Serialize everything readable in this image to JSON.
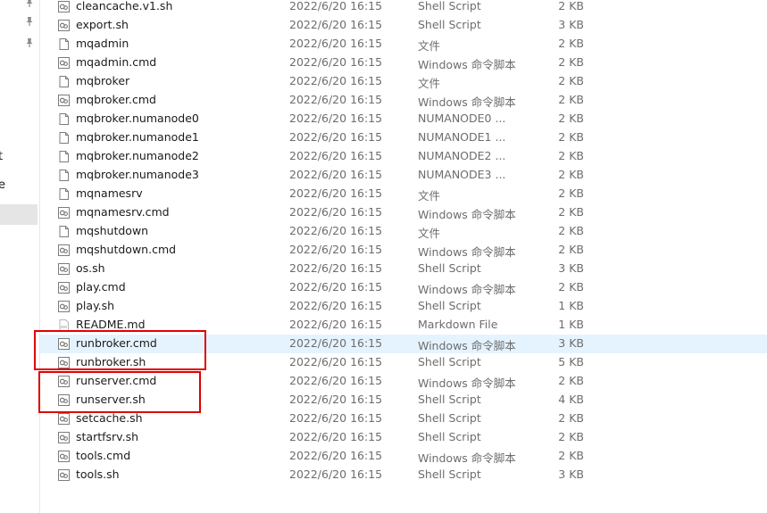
{
  "nav": {
    "text_fragments": [
      "t",
      "e"
    ],
    "icons": [
      "pin-icon",
      "pin-icon",
      "pin-icon"
    ]
  },
  "files": [
    {
      "name": "cleancache.v1.sh",
      "date": "2022/6/20 16:15",
      "type": "Shell Script",
      "size": "2 KB",
      "icon": "script-file-icon"
    },
    {
      "name": "export.sh",
      "date": "2022/6/20 16:15",
      "type": "Shell Script",
      "size": "3 KB",
      "icon": "script-file-icon"
    },
    {
      "name": "mqadmin",
      "date": "2022/6/20 16:15",
      "type": "文件",
      "size": "2 KB",
      "icon": "blank-file-icon"
    },
    {
      "name": "mqadmin.cmd",
      "date": "2022/6/20 16:15",
      "type": "Windows 命令脚本",
      "size": "2 KB",
      "icon": "script-file-icon"
    },
    {
      "name": "mqbroker",
      "date": "2022/6/20 16:15",
      "type": "文件",
      "size": "2 KB",
      "icon": "blank-file-icon"
    },
    {
      "name": "mqbroker.cmd",
      "date": "2022/6/20 16:15",
      "type": "Windows 命令脚本",
      "size": "2 KB",
      "icon": "script-file-icon"
    },
    {
      "name": "mqbroker.numanode0",
      "date": "2022/6/20 16:15",
      "type": "NUMANODE0 ...",
      "size": "2 KB",
      "icon": "blank-file-icon"
    },
    {
      "name": "mqbroker.numanode1",
      "date": "2022/6/20 16:15",
      "type": "NUMANODE1 ...",
      "size": "2 KB",
      "icon": "blank-file-icon"
    },
    {
      "name": "mqbroker.numanode2",
      "date": "2022/6/20 16:15",
      "type": "NUMANODE2 ...",
      "size": "2 KB",
      "icon": "blank-file-icon"
    },
    {
      "name": "mqbroker.numanode3",
      "date": "2022/6/20 16:15",
      "type": "NUMANODE3 ...",
      "size": "2 KB",
      "icon": "blank-file-icon"
    },
    {
      "name": "mqnamesrv",
      "date": "2022/6/20 16:15",
      "type": "文件",
      "size": "2 KB",
      "icon": "blank-file-icon"
    },
    {
      "name": "mqnamesrv.cmd",
      "date": "2022/6/20 16:15",
      "type": "Windows 命令脚本",
      "size": "2 KB",
      "icon": "script-file-icon"
    },
    {
      "name": "mqshutdown",
      "date": "2022/6/20 16:15",
      "type": "文件",
      "size": "2 KB",
      "icon": "blank-file-icon"
    },
    {
      "name": "mqshutdown.cmd",
      "date": "2022/6/20 16:15",
      "type": "Windows 命令脚本",
      "size": "2 KB",
      "icon": "script-file-icon"
    },
    {
      "name": "os.sh",
      "date": "2022/6/20 16:15",
      "type": "Shell Script",
      "size": "3 KB",
      "icon": "script-file-icon"
    },
    {
      "name": "play.cmd",
      "date": "2022/6/20 16:15",
      "type": "Windows 命令脚本",
      "size": "2 KB",
      "icon": "script-file-icon"
    },
    {
      "name": "play.sh",
      "date": "2022/6/20 16:15",
      "type": "Shell Script",
      "size": "1 KB",
      "icon": "script-file-icon"
    },
    {
      "name": "README.md",
      "date": "2022/6/20 16:15",
      "type": "Markdown File",
      "size": "1 KB",
      "icon": "markdown-file-icon"
    },
    {
      "name": "runbroker.cmd",
      "date": "2022/6/20 16:15",
      "type": "Windows 命令脚本",
      "size": "3 KB",
      "icon": "script-file-icon",
      "hover": true
    },
    {
      "name": "runbroker.sh",
      "date": "2022/6/20 16:15",
      "type": "Shell Script",
      "size": "5 KB",
      "icon": "script-file-icon"
    },
    {
      "name": "runserver.cmd",
      "date": "2022/6/20 16:15",
      "type": "Windows 命令脚本",
      "size": "2 KB",
      "icon": "script-file-icon"
    },
    {
      "name": "runserver.sh",
      "date": "2022/6/20 16:15",
      "type": "Shell Script",
      "size": "4 KB",
      "icon": "script-file-icon"
    },
    {
      "name": "setcache.sh",
      "date": "2022/6/20 16:15",
      "type": "Shell Script",
      "size": "2 KB",
      "icon": "script-file-icon"
    },
    {
      "name": "startfsrv.sh",
      "date": "2022/6/20 16:15",
      "type": "Shell Script",
      "size": "2 KB",
      "icon": "script-file-icon"
    },
    {
      "name": "tools.cmd",
      "date": "2022/6/20 16:15",
      "type": "Windows 命令脚本",
      "size": "2 KB",
      "icon": "script-file-icon"
    },
    {
      "name": "tools.sh",
      "date": "2022/6/20 16:15",
      "type": "Shell Script",
      "size": "3 KB",
      "icon": "script-file-icon"
    }
  ],
  "colors": {
    "annotation": "#e00000",
    "hover_row": "#e5f3ff",
    "nav_selected": "#e5e5e5"
  }
}
